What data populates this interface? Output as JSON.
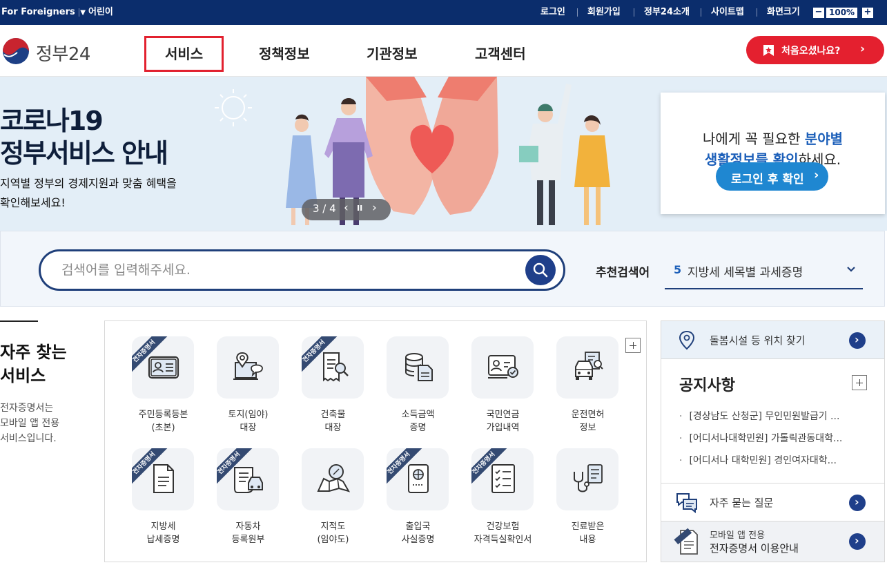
{
  "top_bar": {
    "foreigners": "For Foreigners",
    "kids": "어린이",
    "links": [
      "로그인",
      "회원가입",
      "정부24소개",
      "사이트맵"
    ],
    "zoom_label": "화면크기",
    "zoom_minus": "−",
    "zoom_value": "100%",
    "zoom_plus": "+"
  },
  "header": {
    "logo_text": "정부24",
    "nav": [
      "서비스",
      "정책정보",
      "기관정보",
      "고객센터"
    ],
    "first_visit_button": "처음오셨나요?"
  },
  "banner": {
    "title_line1": "코로나19",
    "title_line2": "정부서비스 안내",
    "desc_line1": "지역별 정부의 경제지원과 맞춤 혜택을",
    "desc_line2": "확인해보세요!",
    "slide_counter": "3 / 4",
    "card_line1_a": "나에게 꼭 필요한 ",
    "card_line1_b": "분야별",
    "card_line2_a": "생활정보를 확인",
    "card_line2_b": "하세요.",
    "card_button": "로그인 후 확인"
  },
  "search": {
    "placeholder": "검색어를 입력해주세요.",
    "recommend_label": "추천검색어",
    "recommend_rank": "5",
    "recommend_text": "지방세 세목별 과세증명"
  },
  "frequent": {
    "title_line1": "자주 찾는",
    "title_line2": "서비스",
    "desc_line1": "전자증명서는",
    "desc_line2": "모바일 앱 전용",
    "desc_line3": "서비스입니다.",
    "ribbon": "전자증명서",
    "services": [
      {
        "line1": "주민등록등본",
        "line2": "(초본)",
        "icon": "id-card-icon"
      },
      {
        "line1": "토지(임야)",
        "line2": "대장",
        "icon": "land-map-icon"
      },
      {
        "line1": "건축물",
        "line2": "대장",
        "icon": "building-ledger-icon"
      },
      {
        "line1": "소득금액",
        "line2": "증명",
        "icon": "income-coins-icon"
      },
      {
        "line1": "국민연금",
        "line2": "가입내역",
        "icon": "pension-card-icon"
      },
      {
        "line1": "운전면허",
        "line2": "정보",
        "icon": "driver-license-icon"
      },
      {
        "line1": "지방세",
        "line2": "납세증명",
        "icon": "tax-document-icon"
      },
      {
        "line1": "자동차",
        "line2": "등록원부",
        "icon": "car-registration-icon"
      },
      {
        "line1": "지적도",
        "line2": "(임야도)",
        "icon": "cadastral-map-icon"
      },
      {
        "line1": "출입국",
        "line2": "사실증명",
        "icon": "passport-icon"
      },
      {
        "line1": "건강보험",
        "line2": "자격득실확인서",
        "icon": "checklist-icon"
      },
      {
        "line1": "진료받은",
        "line2": "내용",
        "icon": "stethoscope-icon"
      }
    ]
  },
  "right_panel": {
    "care_text": "돌봄시설 등 위치 찾기",
    "notice_title": "공지사항",
    "notices": [
      "[경상남도 산청군] 무인민원발급기 ...",
      "[어디서나대학민원] 가톨릭관동대학...",
      "[어디서나 대학민원] 경인여자대학..."
    ],
    "faq_text": "자주 묻는 질문",
    "app_line1": "모바일 앱 전용",
    "app_line2": "전자증명서 이용안내",
    "app_badge": "전자증명서"
  }
}
